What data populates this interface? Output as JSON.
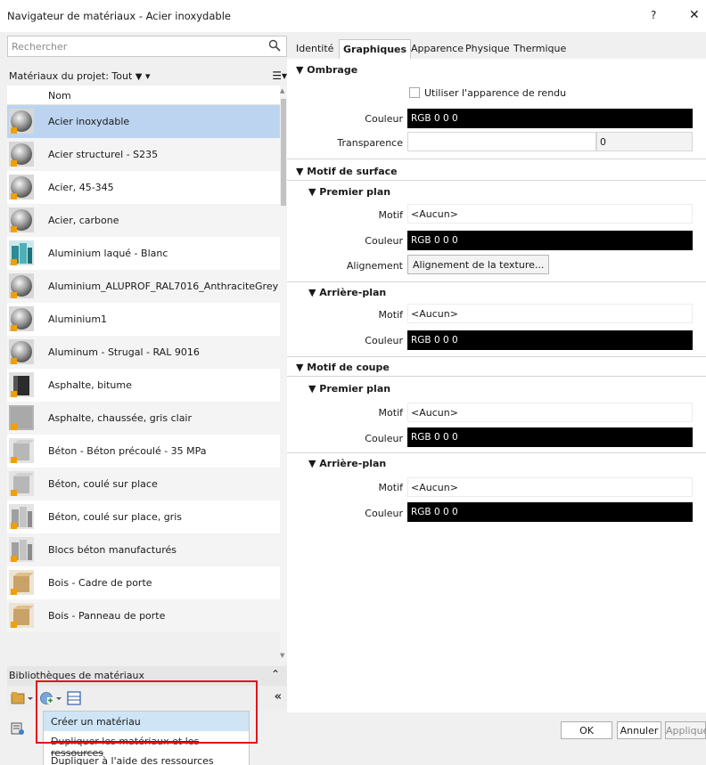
{
  "window": {
    "title": "Navigateur de matériaux - Acier inoxydable",
    "help": "?",
    "close": "✕"
  },
  "search": {
    "placeholder": "Rechercher"
  },
  "filter": {
    "label": "Matériaux du projet: Tout",
    "filter_icon": "▼",
    "dropdown": "▾",
    "listview": "☰▾"
  },
  "list": {
    "header": "Nom",
    "items": [
      {
        "name": "Acier inoxydable",
        "icon": "sphere-metal",
        "selected": true
      },
      {
        "name": "Acier structurel - S235",
        "icon": "sphere-metal"
      },
      {
        "name": "Acier, 45-345",
        "icon": "sphere-metal"
      },
      {
        "name": "Acier, carbone",
        "icon": "sphere-metal"
      },
      {
        "name": "Aluminium laqué - Blanc",
        "icon": "teal-blocks"
      },
      {
        "name": "Aluminium_ALUPROF_RAL7016_AnthraciteGrey",
        "icon": "sphere-metal"
      },
      {
        "name": "Aluminium1",
        "icon": "sphere-metal"
      },
      {
        "name": "Aluminum - Strugal - RAL 9016",
        "icon": "sphere-metal"
      },
      {
        "name": "Asphalte, bitume",
        "icon": "dark-cube"
      },
      {
        "name": "Asphalte, chaussée, gris clair",
        "icon": "gray-texture"
      },
      {
        "name": "Béton - Béton précoulé - 35 MPa",
        "icon": "concrete-cube"
      },
      {
        "name": "Béton, coulé sur place",
        "icon": "concrete-cube"
      },
      {
        "name": "Béton, coulé sur place, gris",
        "icon": "concrete-cubes"
      },
      {
        "name": "Blocs béton manufacturés",
        "icon": "concrete-cubes"
      },
      {
        "name": "Bois - Cadre de porte",
        "icon": "wood-cube"
      },
      {
        "name": "Bois - Panneau de porte",
        "icon": "wood-cube"
      }
    ]
  },
  "library": {
    "label": "Bibliothèques de matériaux",
    "expand": "⌃"
  },
  "toolbar": {
    "collapse": "«"
  },
  "menu": {
    "items": [
      {
        "label": "Créer un matériau"
      },
      {
        "label": "Dupliquer les matériaux et les ressources"
      },
      {
        "label": "Dupliquer à l'aide des ressources partagées"
      }
    ]
  },
  "tabs": [
    "Identité",
    "Graphiques",
    "Apparence",
    "Physique",
    "Thermique"
  ],
  "graphics": {
    "ombrage": "▼ Ombrage",
    "use_render": "Utiliser l'apparence de rendu",
    "couleur_label": "Couleur",
    "couleur_value": "RGB 0 0 0",
    "transparence_label": "Transparence",
    "transparence_value": "0",
    "motif_surface": "▼ Motif de surface",
    "premier_plan": "▼ Premier plan",
    "arriere_plan": "▼ Arrière-plan",
    "motif_label": "Motif",
    "motif_value": "<Aucun>",
    "alignement_label": "Alignement",
    "alignement_button": "Alignement de la texture...",
    "motif_coupe": "▼ Motif de coupe"
  },
  "footer": {
    "ok": "OK",
    "cancel": "Annuler",
    "apply": "Appliquer"
  },
  "colors": {
    "selected_row": "#bcd4f0",
    "highlight_box": "#e3131b",
    "menu_highlight": "#cfe5f6"
  }
}
